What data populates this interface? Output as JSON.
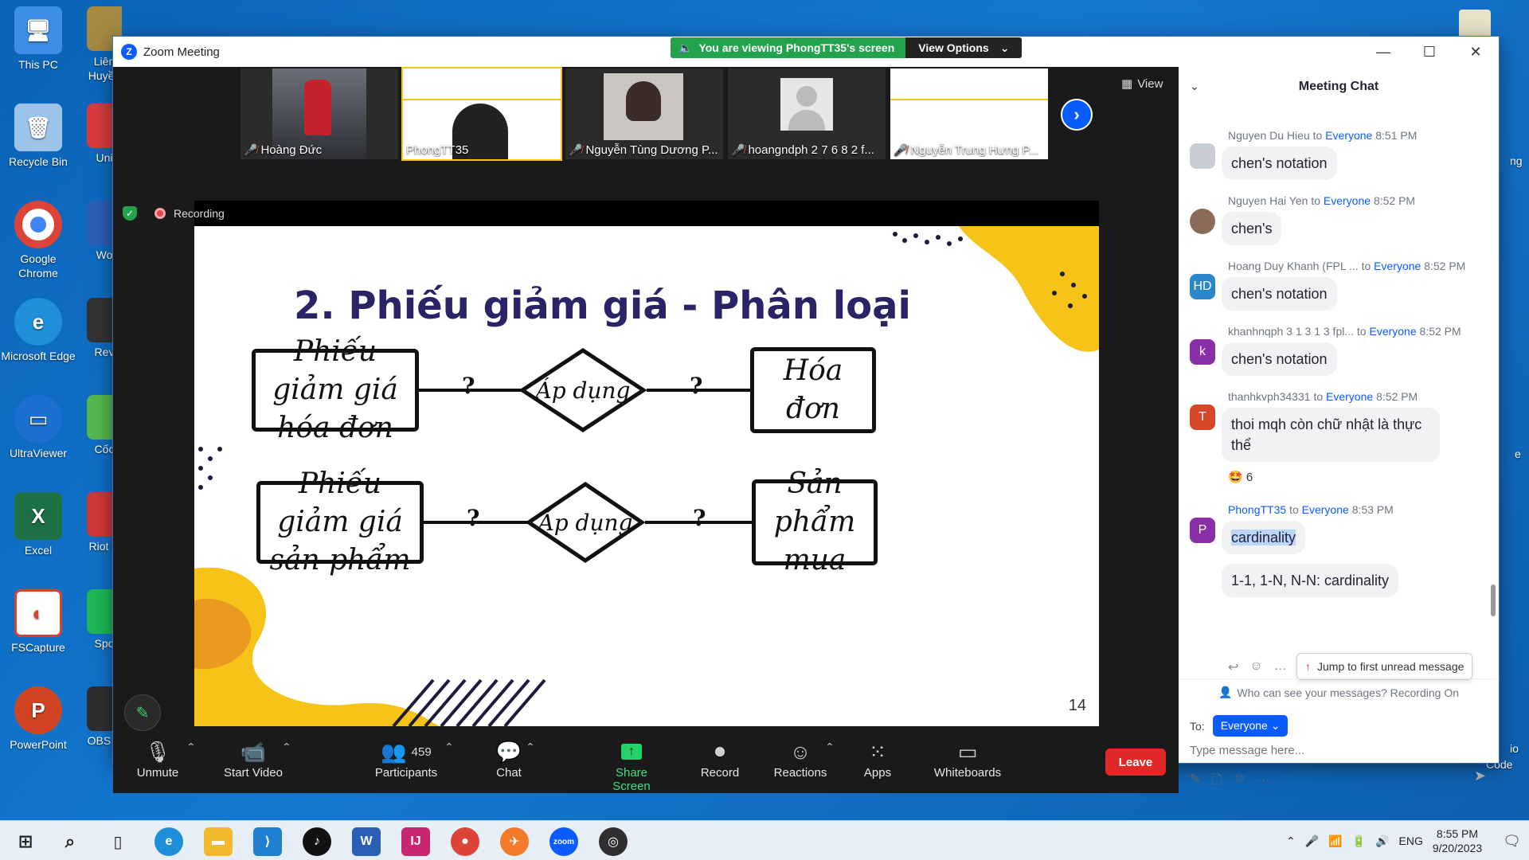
{
  "desktop": {
    "icons": [
      {
        "label": "This PC",
        "color": "#3c8ee6"
      },
      {
        "label": "Recycle Bin",
        "color": "#9cc3ea"
      },
      {
        "label": "Google Chrome",
        "color": "#db4437"
      },
      {
        "label": "Microsoft Edge",
        "color": "#1e8fd8"
      },
      {
        "label": "UltraViewer",
        "color": "#1d6fd0"
      },
      {
        "label": "Excel",
        "color": "#1d7044"
      },
      {
        "label": "FSCapture",
        "color": "#d64431"
      },
      {
        "label": "PowerPoint",
        "color": "#d04423"
      }
    ],
    "col2": [
      {
        "label": "Liên Huyền",
        "color": "#a48a40"
      },
      {
        "label": "Uni",
        "color": "#d93b3b"
      },
      {
        "label": "Wo",
        "color": "#2b5fb6"
      },
      {
        "label": "Rev",
        "color": "#333333"
      },
      {
        "label": "Cốc",
        "color": "#55b84f"
      },
      {
        "label": "Riot C",
        "color": "#d13639"
      },
      {
        "label": "Spo",
        "color": "#1db954"
      },
      {
        "label": "OBS S",
        "color": "#302e31"
      }
    ],
    "right_edge": [
      "ng",
      "e",
      "io",
      "Code"
    ]
  },
  "window": {
    "title": "Zoom Meeting",
    "banner_text": "You are viewing PhongTT35's screen",
    "view_options": "View Options"
  },
  "participants_strip": [
    {
      "name": "Hoàng Đức",
      "muted": true
    },
    {
      "name": "PhongTT35",
      "muted": false
    },
    {
      "name": "Nguyễn Tùng Dương P...",
      "muted": true
    },
    {
      "name": "hoangndph 2 7 6 8 2 f...",
      "muted": true
    },
    {
      "name": "Nguyễn Trung Hưng P...",
      "muted": true
    }
  ],
  "view_label": "View",
  "recording_label": "Recording",
  "slide": {
    "title": "2. Phiếu giảm giá - Phân loại",
    "row1": {
      "left": "Phiếu giảm giá hóa đơn",
      "middle": "Áp dụng",
      "right": "Hóa đơn"
    },
    "row2": {
      "left": "Phiếu giảm giá sản phẩm",
      "middle": "Áp dụng",
      "right": "Sản phẩm mua"
    },
    "qmark": "?",
    "page_number": "14"
  },
  "toolbar": {
    "unmute": "Unmute",
    "start_video": "Start Video",
    "participants": "Participants",
    "participants_count": "459",
    "chat": "Chat",
    "share_screen": "Share Screen",
    "record": "Record",
    "reactions": "Reactions",
    "apps": "Apps",
    "whiteboards": "Whiteboards",
    "leave": "Leave"
  },
  "chat": {
    "header": "Meeting Chat",
    "messages": [
      {
        "sender": "Nguyen Du Hieu",
        "to": "Everyone",
        "time": "8:51 PM",
        "text": "chen's notation",
        "avatar": "",
        "avatar_color": "#c9ced6"
      },
      {
        "sender": "Nguyen Hai Yen",
        "to": "Everyone",
        "time": "8:52 PM",
        "text": "chen's",
        "avatar": "",
        "avatar_color": "#8a6a58"
      },
      {
        "sender": "Hoang Duy Khanh (FPL ...",
        "to": "Everyone",
        "time": "8:52 PM",
        "text": "chen's notation",
        "avatar": "HD",
        "avatar_color": "#2a86c9"
      },
      {
        "sender": "khanhnqph 3 1 3 1 3 fpl...",
        "to": "Everyone",
        "time": "8:52 PM",
        "text": "chen's notation",
        "avatar": "k",
        "avatar_color": "#8b2fa8"
      },
      {
        "sender": "thanhkvph34331",
        "to": "Everyone",
        "time": "8:52 PM",
        "text": "thoi mqh còn chữ nhật là thực thể",
        "avatar": "T",
        "avatar_color": "#d9472b"
      },
      {
        "sender": "PhongTT35",
        "to": "Everyone",
        "time": "8:53 PM",
        "text": "cardinality",
        "text2": "1-1, 1-N, N-N: cardinality",
        "avatar": "P",
        "avatar_color": "#8b2fa8"
      }
    ],
    "reaction_count": "6",
    "to_label": "to",
    "jump_label": "Jump to first unread message",
    "who_can_see": "Who can see your messages? Recording On",
    "to_prefix": "To:",
    "to_value": "Everyone",
    "placeholder": "Type message here..."
  },
  "taskbar": {
    "time": "8:55 PM",
    "date": "9/20/2023",
    "lang": "ENG"
  }
}
